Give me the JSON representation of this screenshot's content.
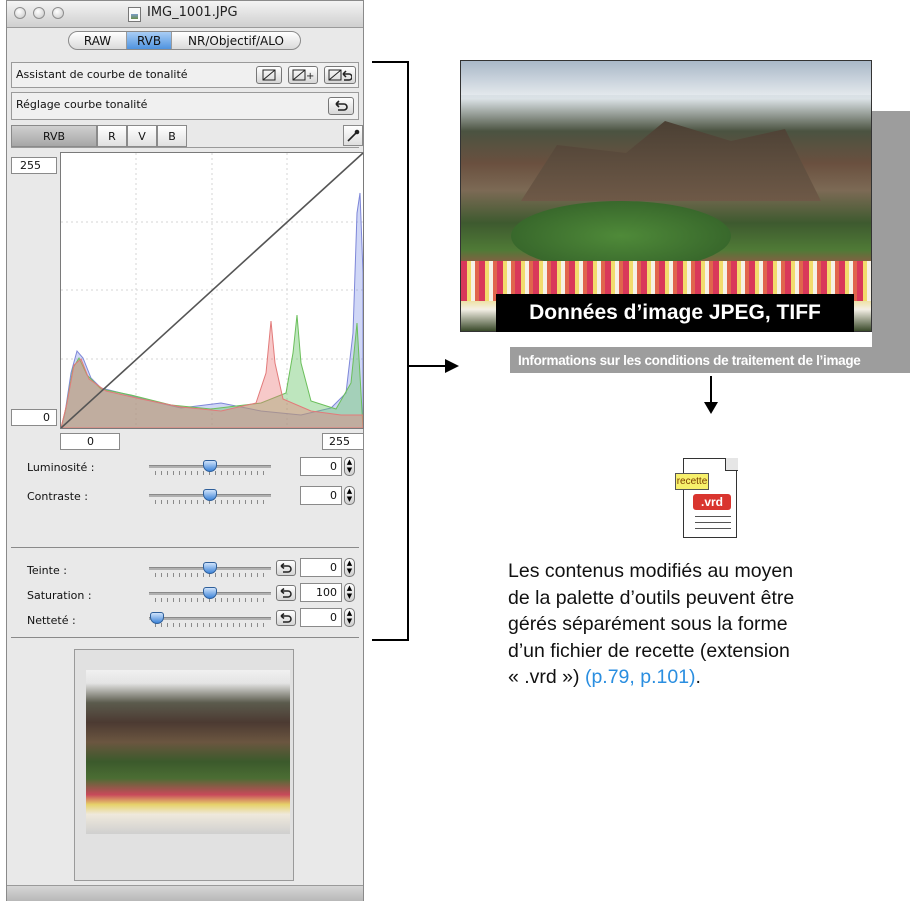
{
  "window": {
    "title": "IMG_1001.JPG",
    "tabs": [
      {
        "label": "RAW",
        "active": false
      },
      {
        "label": "RVB",
        "active": true
      },
      {
        "label": "NR/Objectif/ALO",
        "active": false
      }
    ]
  },
  "tone_assist": {
    "label": "Assistant de courbe de tonalité"
  },
  "tone_curve": {
    "label": "Réglage courbe tonalité"
  },
  "channels": [
    "RVB",
    "R",
    "V",
    "B"
  ],
  "curve": {
    "in_max": "255",
    "out_min": "0",
    "x_min": "0",
    "x_max": "255"
  },
  "adjustments": {
    "brightness": {
      "label": "Luminosité :",
      "value": "0",
      "level": 0.5
    },
    "contrast": {
      "label": "Contraste :",
      "value": "0",
      "level": 0.5
    },
    "hue": {
      "label": "Teinte :",
      "value": "0",
      "level": 0.5
    },
    "saturation": {
      "label": "Saturation :",
      "value": "100",
      "level": 0.5
    },
    "sharpness": {
      "label": "Netteté :",
      "value": "0",
      "level": 0.0
    }
  },
  "right": {
    "banner": "Données d’image JPEG, TIFF",
    "caption": "Informations sur les conditions de traitement de l’image",
    "recipe_tag": "recette",
    "recipe_ext": ".vrd",
    "desc_lines": [
      "Les contenus modifiés au moyen",
      "de la palette d’outils peuvent être",
      "gérés séparément sous la forme",
      "d’un fichier de recette (extension"
    ],
    "desc_last": "« .vrd »)",
    "desc_refs": "(p.79, p.101)",
    "desc_end": "."
  },
  "colors": {
    "accent_blue": "#4f93df",
    "link_blue": "#2a8ee0",
    "recipe_red": "#d9352f",
    "recipe_yellow": "#f7f06b",
    "caption_gray": "#9d9d9d"
  }
}
